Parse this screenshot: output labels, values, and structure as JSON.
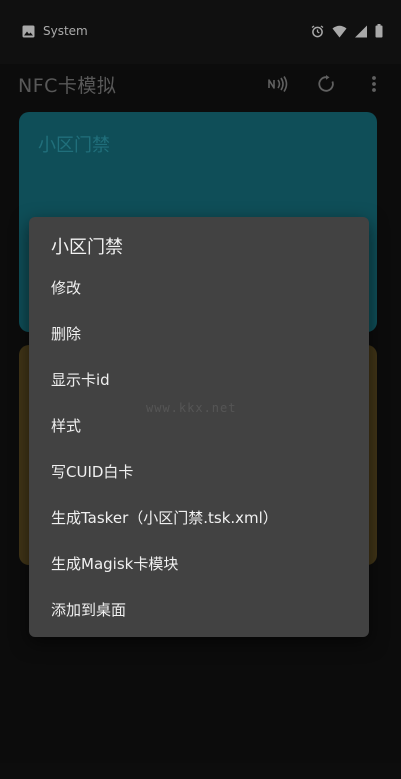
{
  "status_bar": {
    "app_label": "System",
    "icons": [
      "image-icon",
      "alarm-icon",
      "wifi-icon",
      "signal-icon",
      "battery-icon"
    ]
  },
  "app_bar": {
    "title": "NFC卡模拟",
    "actions": [
      "nfc-icon",
      "refresh-icon",
      "more-vert-icon"
    ]
  },
  "cards": [
    {
      "title": "小区门禁",
      "color": "#16707f"
    },
    {
      "title": "",
      "color": "#5d4d22"
    }
  ],
  "menu": {
    "title": "小区门禁",
    "items": [
      "修改",
      "删除",
      "显示卡id",
      "样式",
      "写CUID白卡",
      "生成Tasker（小区门禁.tsk.xml）",
      "生成Magisk卡模块",
      "添加到桌面"
    ]
  },
  "watermark": "www.kkx.net"
}
